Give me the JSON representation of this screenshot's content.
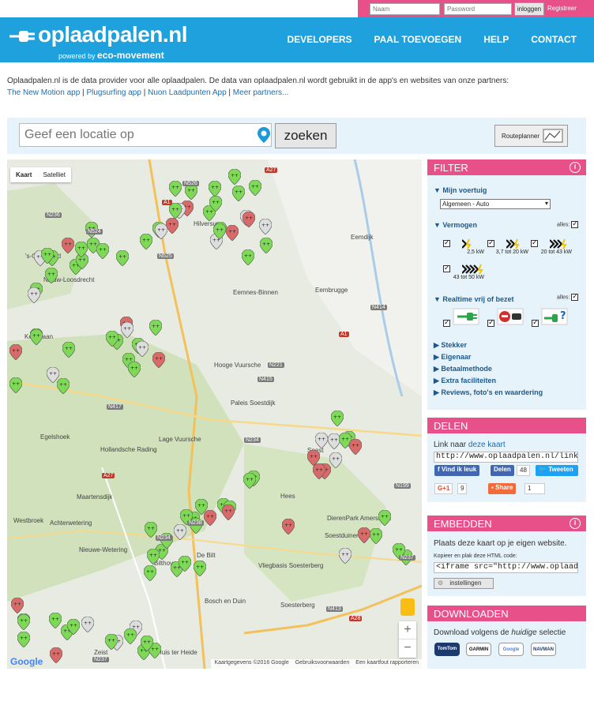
{
  "login": {
    "name_placeholder": "Naam",
    "password_placeholder": "Password",
    "login_label": "inloggen",
    "register_label": "Registreer"
  },
  "header": {
    "logo": "oplaadpalen.nl",
    "powered_by": "powered by",
    "powered_brand": "eco-movement",
    "nav": [
      "DEVELOPERS",
      "PAAL TOEVOEGEN",
      "HELP",
      "CONTACT"
    ]
  },
  "intro": {
    "text": "Oplaadpalen.nl is de data provider voor alle oplaadpalen. De data van oplaadpalen.nl wordt gebruikt in de app's en websites van onze partners:",
    "partners": [
      "The New Motion app",
      "Plugsurfing app",
      "Nuon Laadpunten App",
      "Meer partners..."
    ]
  },
  "search": {
    "placeholder": "Geef een locatie op",
    "button": "zoeken",
    "routeplanner": "Routeplanner"
  },
  "map": {
    "tabs": [
      "Kaart",
      "Satelliet"
    ],
    "labels": [
      "'s-Graveland",
      "Nieuw-Loosdrecht",
      "Kerkelaan",
      "Egelshoek",
      "Lage Vuursche",
      "Hollandsche Rading",
      "Maartensdijk",
      "Westbroek",
      "Achterwetering",
      "Nieuwe-Wetering",
      "Bilthoven",
      "De Bilt",
      "Hilversum",
      "Eemnes-Binnen",
      "Eembrugge",
      "Eemdijk",
      "Hooge Vuursche",
      "Paleis Soestdijk",
      "Soest",
      "Hees",
      "DierenPark Amersfoort",
      "Soestduinen",
      "Vliegbasis Soesterberg",
      "Bosch en Duin",
      "Soesterberg",
      "Zeist",
      "Huis ter Heide"
    ],
    "roads": [
      "A27",
      "N526",
      "A1",
      "N236",
      "N524",
      "N525",
      "N414",
      "A1",
      "N221",
      "N415",
      "N417",
      "N234",
      "A27",
      "N238",
      "N234",
      "N237",
      "N413",
      "A28",
      "N237",
      "N199"
    ],
    "footer": [
      "Kaartgegevens ©2016 Google",
      "Gebruiksvoorwaarden",
      "Een kaartfout rapporteren"
    ],
    "google": "Google",
    "zoom_in": "+",
    "zoom_out": "−"
  },
  "filter": {
    "title": "FILTER",
    "voertuig_label": "Mijn voertuig",
    "voertuig_value": "Algemeen - Auto",
    "vermogen_label": "Vermogen",
    "alles": "alles:",
    "power_levels": [
      "2,5 kW",
      "3,7 tot 20 kW",
      "20 tot 43 kW",
      "43 tot 50 kW"
    ],
    "realtime_label": "Realtime vrij of bezet",
    "sections": [
      "Stekker",
      "Eigenaar",
      "Betaalmethode",
      "Extra faciliteiten",
      "Reviews, foto's en waardering"
    ]
  },
  "delen": {
    "title": "DELEN",
    "text": "Link naar",
    "link_text": "deze kaart",
    "url": "http://www.oplaadpalen.nl/link",
    "fb_label": "Vind ik leuk",
    "fb_share": "Delen",
    "fb_count": "48",
    "tweet": "Tweeten",
    "gplus": "G+1",
    "gplus_count": "9",
    "share": "Share",
    "share_count": "1"
  },
  "embed": {
    "title": "EMBEDDEN",
    "text": "Plaats deze kaart op je eigen website.",
    "hint": "Kopieer en plak deze HTML code:",
    "code": "<iframe src=\"http://www.oplaad",
    "settings": "instellingen"
  },
  "download": {
    "title": "DOWNLOADEN",
    "text_pre": "Download volgens de",
    "text_em": "huidige",
    "text_post": "selectie",
    "brands": [
      "TomTom",
      "GARMIN",
      "Google",
      "NAVMAN"
    ]
  },
  "colors": {
    "header": "#1ea1dd",
    "accent": "#e8508a",
    "panel_bg": "#e6f3fa",
    "marker_green": "#7ed957",
    "marker_red": "#d96a6a"
  }
}
